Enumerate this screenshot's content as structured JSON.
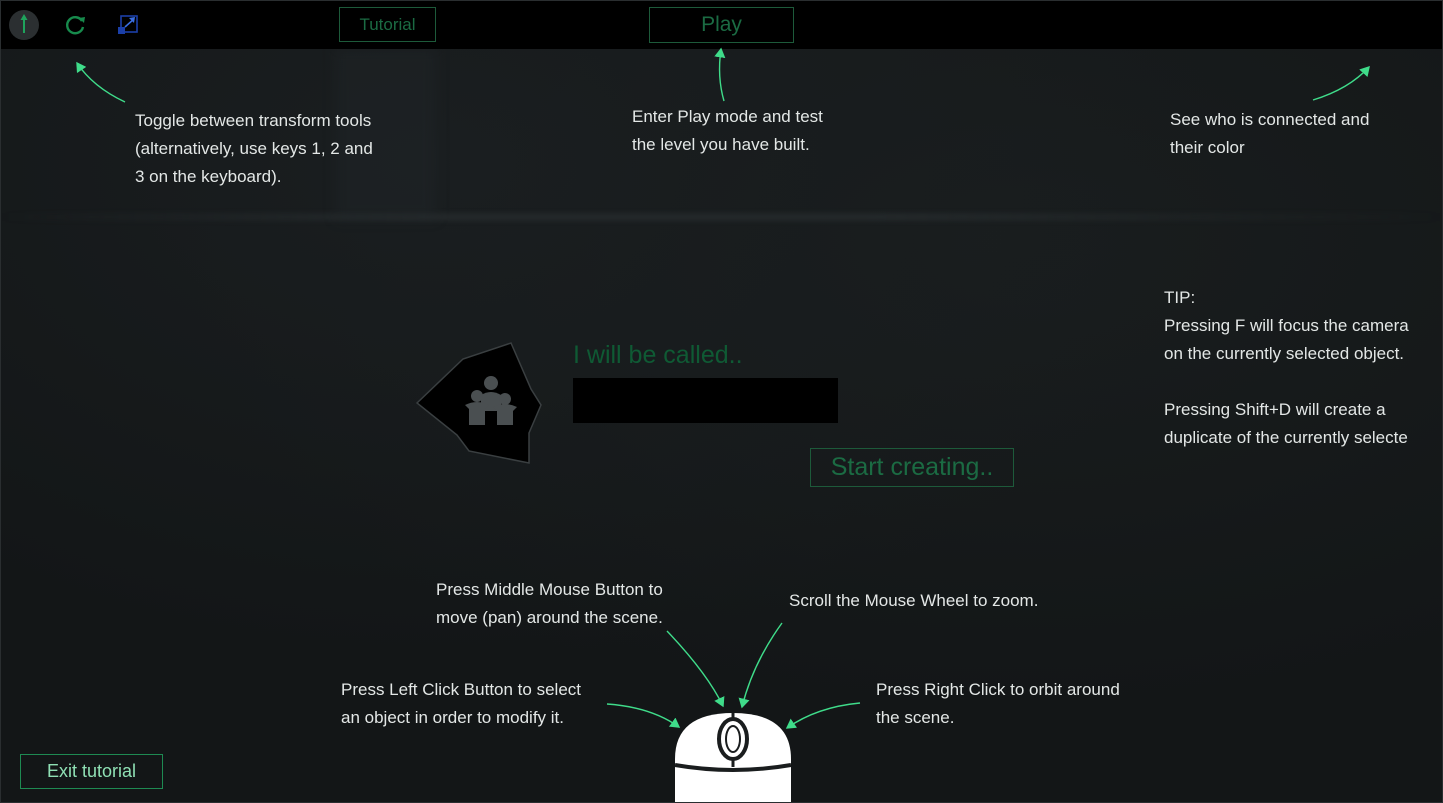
{
  "toolbar": {
    "tools": [
      {
        "name": "move-tool-icon",
        "icon": "move-arrows-icon"
      },
      {
        "name": "rotate-tool-icon",
        "icon": "rotate-icon"
      },
      {
        "name": "scale-tool-icon",
        "icon": "scale-icon"
      }
    ],
    "tutorial_label": "Tutorial",
    "play_label": "Play"
  },
  "notes": {
    "transform_tools": [
      "Toggle between transform tools",
      "(alternatively, use keys 1, 2 and",
      "3 on the keyboard)."
    ],
    "play_mode": [
      "Enter Play mode and test",
      "the level you have built."
    ],
    "connected_users": [
      "See who is connected and",
      "their color"
    ],
    "tip": [
      "TIP:",
      "Pressing F will focus the camera",
      "on the currently selected object.",
      "",
      "Pressing Shift+D will create a",
      "duplicate of the currently selecte"
    ],
    "middle_mouse": [
      "Press Middle Mouse Button to",
      "move (pan) around the scene."
    ],
    "scroll_wheel": [
      "Scroll the Mouse Wheel to zoom."
    ],
    "left_click": [
      "Press Left Click Button to select",
      "an object in order to modify it."
    ],
    "right_click": [
      "Press Right Click to orbit around",
      "the scene."
    ]
  },
  "name_form": {
    "label": "I will be called..",
    "input_value": "",
    "input_placeholder": "",
    "start_label": "Start creating.."
  },
  "exit_label": "Exit tutorial",
  "colors": {
    "background": "#131617",
    "toolbar": "#000000",
    "accent_green": "#1e8a52",
    "dim_green": "#0f5a34",
    "arrow_green": "#3fdc8a",
    "text": "#e3e7e6"
  }
}
